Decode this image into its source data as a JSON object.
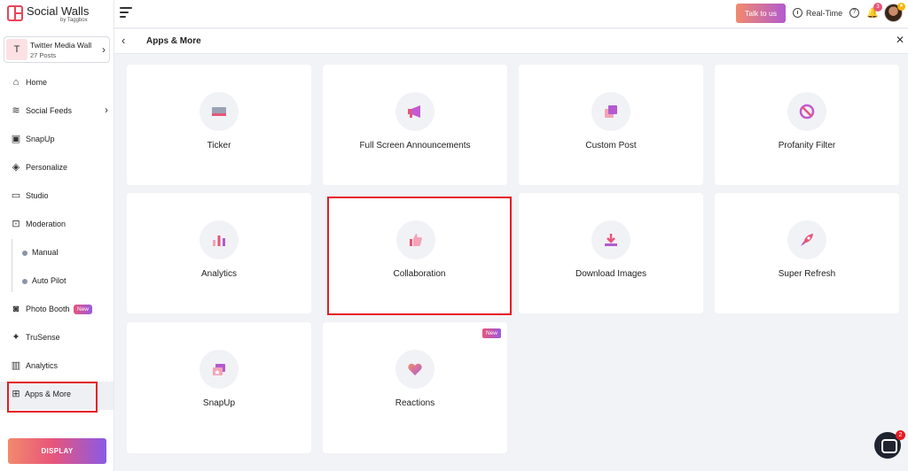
{
  "brand": {
    "name": "Social Walls",
    "sub": "by Taggbox"
  },
  "wall": {
    "avatar": "T",
    "title": "Twitter Media Wall",
    "posts": "27 Posts"
  },
  "nav": {
    "home": "Home",
    "social_feeds": "Social Feeds",
    "snapup": "SnapUp",
    "personalize": "Personalize",
    "studio": "Studio",
    "moderation": "Moderation",
    "manual": "Manual",
    "auto_pilot": "Auto Pilot",
    "photo_booth": "Photo Booth",
    "photo_booth_badge": "New",
    "trusense": "TruSense",
    "analytics": "Analytics",
    "apps_more": "Apps & More"
  },
  "display_button": "DISPLAY",
  "header": {
    "talk_button": "Talk to us",
    "realtime": "Real-Time",
    "help": "?",
    "bell_count": "3",
    "avatar_star": "★"
  },
  "page": {
    "title": "Apps & More"
  },
  "cards": [
    {
      "title": "Ticker",
      "icon": "ticker-icon"
    },
    {
      "title": "Full Screen Announcements",
      "icon": "megaphone-icon"
    },
    {
      "title": "Custom Post",
      "icon": "custom-post-icon"
    },
    {
      "title": "Profanity Filter",
      "icon": "profanity-filter-icon"
    },
    {
      "title": "Analytics",
      "icon": "bar-chart-icon"
    },
    {
      "title": "Collaboration",
      "icon": "thumbs-up-icon"
    },
    {
      "title": "Download Images",
      "icon": "download-icon"
    },
    {
      "title": "Super Refresh",
      "icon": "rocket-icon"
    },
    {
      "title": "SnapUp",
      "icon": "snapup-icon"
    },
    {
      "title": "Reactions",
      "icon": "heart-icon",
      "badge": "New"
    }
  ],
  "chat_badge": "2",
  "colors": {
    "accent_pink": "#e8557a",
    "accent_purple": "#8a5ae6",
    "highlight_red": "#e51c23"
  }
}
